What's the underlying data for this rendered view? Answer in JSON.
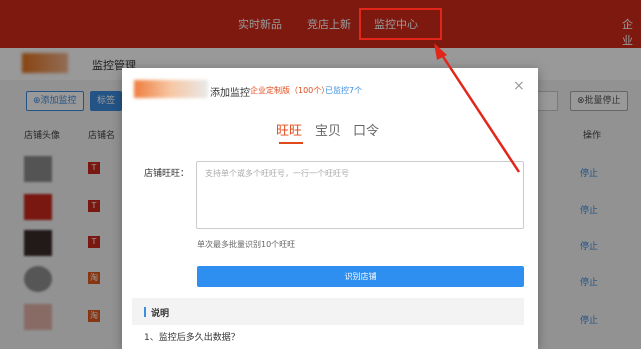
{
  "topnav": {
    "items": [
      "实时新品",
      "竞店上新",
      "监控中心",
      "企业"
    ]
  },
  "page": {
    "title": "监控管理",
    "add_monitor_label": "⊕添加监控",
    "tag_label": "标签",
    "batch_stop_label": "⊗批量停止",
    "columns": {
      "shop_avatar": "店铺头像",
      "shop_name": "店铺名",
      "action": "操作"
    },
    "rows": [
      {
        "avatar_color": "#8d8d8d",
        "stop": "停止"
      },
      {
        "avatar_color": "#c8281c",
        "stop": "停止"
      },
      {
        "avatar_color": "#3a2a2a",
        "stop": "停止"
      },
      {
        "avatar_color": "#8f8f8f",
        "stop": "停止"
      },
      {
        "avatar_color": "#e3b3a8",
        "stop": "停止"
      }
    ]
  },
  "modal": {
    "title": "添加监控",
    "subtitle_plan": "企业定制版（100个）",
    "subtitle_count": "已监控7个",
    "close_symbol": "×",
    "tabs": [
      "旺旺",
      "宝贝",
      "口令"
    ],
    "field_label": "店铺旺旺：",
    "textarea_placeholder": "支持单个或多个旺旺号，一行一个旺旺号",
    "hint": "单次最多批量识别10个旺旺",
    "primary_button": "识别店铺",
    "info_title": "说明",
    "faq_first": "1、监控后多久出数据？"
  },
  "colors": {
    "nav_red": "#d22b1c",
    "primary_blue": "#2e8ff0",
    "accent_orange": "#e04a1a",
    "annotation_red": "#e0271a"
  }
}
